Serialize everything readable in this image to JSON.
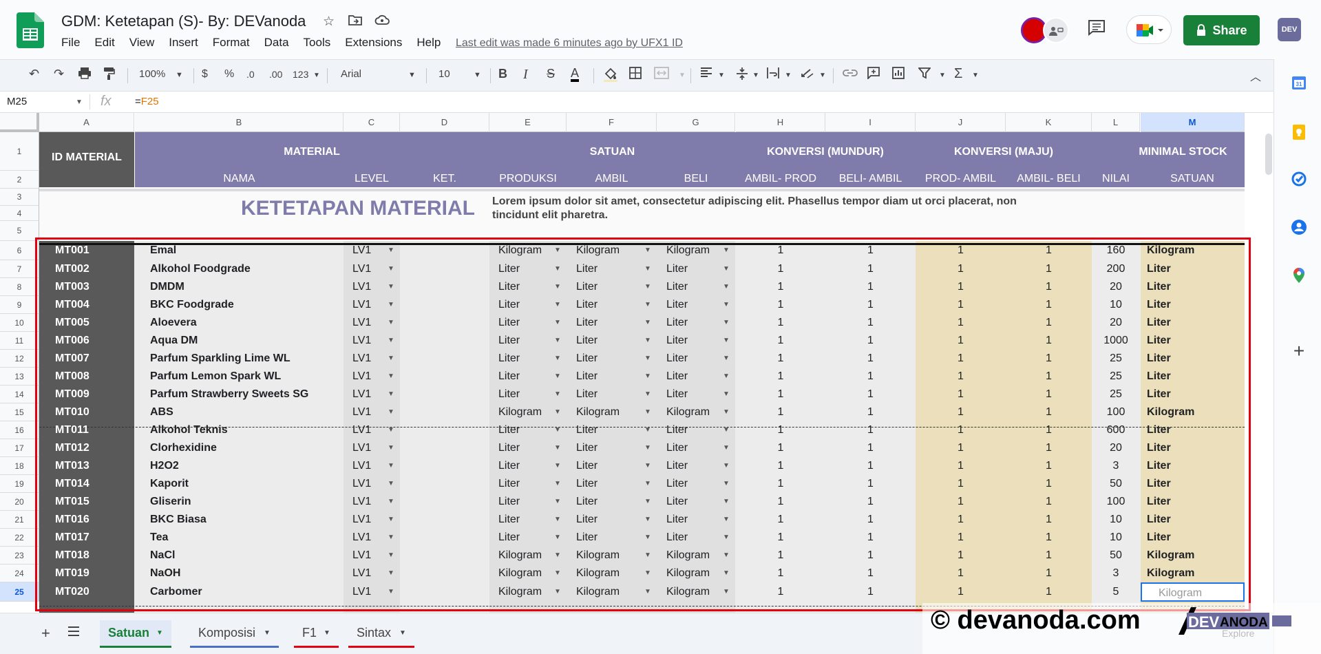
{
  "app": {
    "doc_title": "GDM: Ketetapan (S)- By: DEVanoda",
    "menu": [
      "File",
      "Edit",
      "View",
      "Insert",
      "Format",
      "Data",
      "Tools",
      "Extensions",
      "Help"
    ],
    "last_edit": "Last edit was made 6 minutes ago by UFX1 ID",
    "share_label": "Share",
    "account_label": "DEV"
  },
  "toolbar": {
    "zoom": "100%",
    "currency": "$",
    "percent": "%",
    "dec_less": ".0",
    "dec_more": ".00",
    "format_more": "123",
    "font": "Arial",
    "font_size": "10",
    "bold": "B",
    "italic": "I",
    "strike": "S",
    "text_color": "A",
    "functions": "Σ"
  },
  "formula_bar": {
    "name_box": "M25",
    "fx": "fx",
    "formula_prefix": "=",
    "formula_ref": "F25"
  },
  "colors": {
    "header_purple": "#7f7baa",
    "id_col_dark": "#595959",
    "yellow_fill": "#ebe0bb",
    "title_purple": "#7f7baa",
    "share_green": "#188038",
    "highlight_red": "#e3000f"
  },
  "columns": [
    "A",
    "B",
    "C",
    "D",
    "E",
    "F",
    "G",
    "H",
    "I",
    "J",
    "K",
    "L",
    "M"
  ],
  "rows": [
    "1",
    "2",
    "3",
    "4",
    "5",
    "6",
    "7",
    "8",
    "9",
    "10",
    "11",
    "12",
    "13",
    "14",
    "15",
    "16",
    "17",
    "18",
    "19",
    "20",
    "21",
    "22",
    "23",
    "24",
    "25"
  ],
  "headers": {
    "id_material": "ID MATERIAL",
    "material": "MATERIAL",
    "satuan": "SATUAN",
    "konversi_mundur": "KONVERSI (MUNDUR)",
    "konversi_maju": "KONVERSI (MAJU)",
    "minimal_stock": "MINIMAL STOCK",
    "nama": "NAMA",
    "level": "LEVEL",
    "ket": "KET.",
    "produksi": "PRODUKSI",
    "ambil": "AMBIL",
    "beli": "BELI",
    "ambil_prod": "AMBIL- PROD",
    "beli_ambil": "BELI- AMBIL",
    "prod_ambil": "PROD- AMBIL",
    "ambil_beli": "AMBIL- BELI",
    "nilai": "NILAI",
    "satuan_sub": "SATUAN"
  },
  "banner": {
    "title": "KETETAPAN MATERIAL",
    "description_1": "Lorem ipsum dolor sit amet, consectetur adipiscing elit. Phasellus tempor diam ut orci placerat, non",
    "description_2": "tincidunt elit pharetra."
  },
  "materials": [
    {
      "id": "MT001",
      "name": "Emal",
      "level": "LV1",
      "produksi": "Kilogram",
      "ambil": "Kilogram",
      "beli": "Kilogram",
      "ambil_prod": "1",
      "beli_ambil": "1",
      "prod_ambil": "1",
      "ambil_beli": "1",
      "nilai": "160",
      "satuan": "Kilogram"
    },
    {
      "id": "MT002",
      "name": "Alkohol Foodgrade",
      "level": "LV1",
      "produksi": "Liter",
      "ambil": "Liter",
      "beli": "Liter",
      "ambil_prod": "1",
      "beli_ambil": "1",
      "prod_ambil": "1",
      "ambil_beli": "1",
      "nilai": "200",
      "satuan": "Liter"
    },
    {
      "id": "MT003",
      "name": "DMDM",
      "level": "LV1",
      "produksi": "Liter",
      "ambil": "Liter",
      "beli": "Liter",
      "ambil_prod": "1",
      "beli_ambil": "1",
      "prod_ambil": "1",
      "ambil_beli": "1",
      "nilai": "20",
      "satuan": "Liter"
    },
    {
      "id": "MT004",
      "name": "BKC Foodgrade",
      "level": "LV1",
      "produksi": "Liter",
      "ambil": "Liter",
      "beli": "Liter",
      "ambil_prod": "1",
      "beli_ambil": "1",
      "prod_ambil": "1",
      "ambil_beli": "1",
      "nilai": "10",
      "satuan": "Liter"
    },
    {
      "id": "MT005",
      "name": "Aloevera",
      "level": "LV1",
      "produksi": "Liter",
      "ambil": "Liter",
      "beli": "Liter",
      "ambil_prod": "1",
      "beli_ambil": "1",
      "prod_ambil": "1",
      "ambil_beli": "1",
      "nilai": "20",
      "satuan": "Liter"
    },
    {
      "id": "MT006",
      "name": "Aqua DM",
      "level": "LV1",
      "produksi": "Liter",
      "ambil": "Liter",
      "beli": "Liter",
      "ambil_prod": "1",
      "beli_ambil": "1",
      "prod_ambil": "1",
      "ambil_beli": "1",
      "nilai": "1000",
      "satuan": "Liter"
    },
    {
      "id": "MT007",
      "name": "Parfum Sparkling Lime WL",
      "level": "LV1",
      "produksi": "Liter",
      "ambil": "Liter",
      "beli": "Liter",
      "ambil_prod": "1",
      "beli_ambil": "1",
      "prod_ambil": "1",
      "ambil_beli": "1",
      "nilai": "25",
      "satuan": "Liter"
    },
    {
      "id": "MT008",
      "name": "Parfum Lemon Spark WL",
      "level": "LV1",
      "produksi": "Liter",
      "ambil": "Liter",
      "beli": "Liter",
      "ambil_prod": "1",
      "beli_ambil": "1",
      "prod_ambil": "1",
      "ambil_beli": "1",
      "nilai": "25",
      "satuan": "Liter"
    },
    {
      "id": "MT009",
      "name": "Parfum Strawberry Sweets SG",
      "level": "LV1",
      "produksi": "Liter",
      "ambil": "Liter",
      "beli": "Liter",
      "ambil_prod": "1",
      "beli_ambil": "1",
      "prod_ambil": "1",
      "ambil_beli": "1",
      "nilai": "25",
      "satuan": "Liter"
    },
    {
      "id": "MT010",
      "name": "ABS",
      "level": "LV1",
      "produksi": "Kilogram",
      "ambil": "Kilogram",
      "beli": "Kilogram",
      "ambil_prod": "1",
      "beli_ambil": "1",
      "prod_ambil": "1",
      "ambil_beli": "1",
      "nilai": "100",
      "satuan": "Kilogram"
    },
    {
      "id": "MT011",
      "name": "Alkohol Teknis",
      "level": "LV1",
      "produksi": "Liter",
      "ambil": "Liter",
      "beli": "Liter",
      "ambil_prod": "1",
      "beli_ambil": "1",
      "prod_ambil": "1",
      "ambil_beli": "1",
      "nilai": "600",
      "satuan": "Liter"
    },
    {
      "id": "MT012",
      "name": "Clorhexidine",
      "level": "LV1",
      "produksi": "Liter",
      "ambil": "Liter",
      "beli": "Liter",
      "ambil_prod": "1",
      "beli_ambil": "1",
      "prod_ambil": "1",
      "ambil_beli": "1",
      "nilai": "20",
      "satuan": "Liter"
    },
    {
      "id": "MT013",
      "name": "H2O2",
      "level": "LV1",
      "produksi": "Liter",
      "ambil": "Liter",
      "beli": "Liter",
      "ambil_prod": "1",
      "beli_ambil": "1",
      "prod_ambil": "1",
      "ambil_beli": "1",
      "nilai": "3",
      "satuan": "Liter"
    },
    {
      "id": "MT014",
      "name": "Kaporit",
      "level": "LV1",
      "produksi": "Liter",
      "ambil": "Liter",
      "beli": "Liter",
      "ambil_prod": "1",
      "beli_ambil": "1",
      "prod_ambil": "1",
      "ambil_beli": "1",
      "nilai": "50",
      "satuan": "Liter"
    },
    {
      "id": "MT015",
      "name": "Gliserin",
      "level": "LV1",
      "produksi": "Liter",
      "ambil": "Liter",
      "beli": "Liter",
      "ambil_prod": "1",
      "beli_ambil": "1",
      "prod_ambil": "1",
      "ambil_beli": "1",
      "nilai": "100",
      "satuan": "Liter"
    },
    {
      "id": "MT016",
      "name": "BKC Biasa",
      "level": "LV1",
      "produksi": "Liter",
      "ambil": "Liter",
      "beli": "Liter",
      "ambil_prod": "1",
      "beli_ambil": "1",
      "prod_ambil": "1",
      "ambil_beli": "1",
      "nilai": "10",
      "satuan": "Liter"
    },
    {
      "id": "MT017",
      "name": "Tea",
      "level": "LV1",
      "produksi": "Liter",
      "ambil": "Liter",
      "beli": "Liter",
      "ambil_prod": "1",
      "beli_ambil": "1",
      "prod_ambil": "1",
      "ambil_beli": "1",
      "nilai": "10",
      "satuan": "Liter"
    },
    {
      "id": "MT018",
      "name": "NaCl",
      "level": "LV1",
      "produksi": "Kilogram",
      "ambil": "Kilogram",
      "beli": "Kilogram",
      "ambil_prod": "1",
      "beli_ambil": "1",
      "prod_ambil": "1",
      "ambil_beli": "1",
      "nilai": "50",
      "satuan": "Kilogram"
    },
    {
      "id": "MT019",
      "name": "NaOH",
      "level": "LV1",
      "produksi": "Kilogram",
      "ambil": "Kilogram",
      "beli": "Kilogram",
      "ambil_prod": "1",
      "beli_ambil": "1",
      "prod_ambil": "1",
      "ambil_beli": "1",
      "nilai": "3",
      "satuan": "Kilogram"
    },
    {
      "id": "MT020",
      "name": "Carbomer",
      "level": "LV1",
      "produksi": "Kilogram",
      "ambil": "Kilogram",
      "beli": "Kilogram",
      "ambil_prod": "1",
      "beli_ambil": "1",
      "prod_ambil": "1",
      "ambil_beli": "1",
      "nilai": "5",
      "satuan": "Kilogram"
    }
  ],
  "sheet_tabs": [
    {
      "label": "Satuan",
      "active": true
    },
    {
      "label": "Komposisi",
      "active": false
    },
    {
      "label": "F1",
      "active": false
    },
    {
      "label": "Sintax",
      "active": false
    }
  ],
  "watermark": {
    "text": "© devanoda.com",
    "logo_text": "DEVANODA",
    "explore": "Explore"
  }
}
